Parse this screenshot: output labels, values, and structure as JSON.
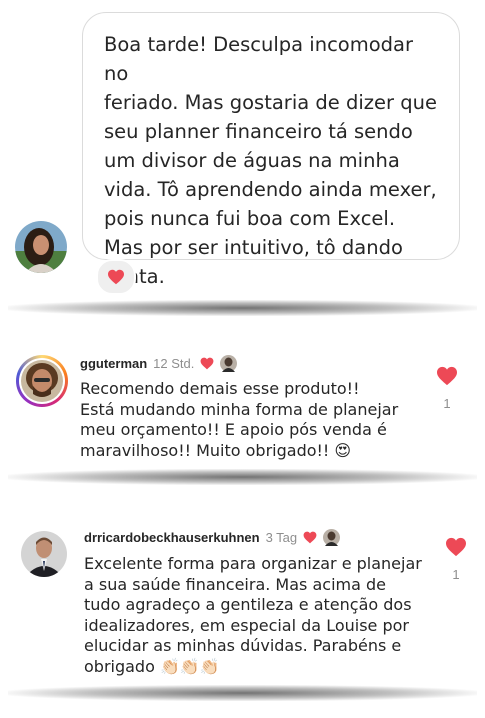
{
  "dm": {
    "message_lines": [
      "Boa tarde! Desculpa incomodar no",
      "feriado. Mas gostaria de dizer que",
      "seu planner financeiro tá sendo",
      "um divisor de águas na minha",
      "vida. Tô aprendendo ainda mexer,",
      "pois nunca fui boa com Excel.",
      "Mas por ser intuitivo, tô dando",
      "conta."
    ],
    "reaction_icon": "heart-icon",
    "reaction_color": "#ed4956"
  },
  "comments": [
    {
      "username": "gguterman",
      "time": "12 Std.",
      "lines": [
        "Recomendo demais esse produto!!",
        "Está mudando minha forma de planejar",
        "meu orçamento!! E apoio pós venda é",
        "maravilhoso!! Muito obrigado!! 😍"
      ],
      "like_count": "1"
    },
    {
      "username": "drricardobeckhauserkuhnen",
      "time": "3 Tag",
      "lines": [
        "Excelente forma para organizar e planejar",
        "a sua saúde financeira. Mas acima de",
        "tudo agradeço a gentileza e atenção dos",
        "idealizadores, em especial da Louise por",
        "elucidar as minhas dúvidas. Parabéns e",
        "obrigado 👏🏻👏🏻👏🏻"
      ],
      "like_count": "1"
    }
  ],
  "colors": {
    "heart": "#ed4956",
    "meta_gray": "#8e8e8e",
    "text": "#262626"
  }
}
